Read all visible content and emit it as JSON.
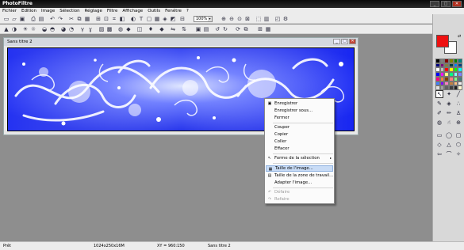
{
  "app": {
    "title": "PhotoFiltre",
    "window_buttons": [
      "_",
      "□",
      "✕"
    ]
  },
  "menubar": [
    "Fichier",
    "Edition",
    "Image",
    "Sélection",
    "Réglage",
    "Filtre",
    "Affichage",
    "Outils",
    "Fenêtre",
    "?"
  ],
  "toolbar": {
    "zoom_value": "100%",
    "zoom_dropdown_icon": "▾"
  },
  "document": {
    "title": "Sans titre 2",
    "buttons": [
      "_",
      "□",
      "✕"
    ]
  },
  "context_menu": {
    "items": [
      {
        "label": "Enregistrer",
        "icon": "save-icon",
        "glyph": "▣"
      },
      {
        "label": "Enregistrer sous...",
        "icon": "",
        "glyph": ""
      },
      {
        "label": "Fermer",
        "icon": "",
        "glyph": ""
      },
      {
        "label": "Couper",
        "icon": "",
        "glyph": ""
      },
      {
        "label": "Copier",
        "icon": "",
        "glyph": ""
      },
      {
        "label": "Coller",
        "icon": "",
        "glyph": ""
      },
      {
        "label": "Effacer",
        "icon": "",
        "glyph": ""
      },
      {
        "label": "Forme de la sélection",
        "icon": "pointer-icon",
        "glyph": "↖",
        "submenu_arrow": "▸"
      },
      {
        "label": "Taille de l'image...",
        "icon": "image-size-icon",
        "glyph": "▦"
      },
      {
        "label": "Taille de la zone de travail...",
        "icon": "canvas-size-icon",
        "glyph": "▤"
      },
      {
        "label": "Adapter l'image...",
        "icon": "",
        "glyph": ""
      },
      {
        "label": "Défaire",
        "icon": "undo-icon",
        "glyph": "↶"
      },
      {
        "label": "Refaire",
        "icon": "redo-icon",
        "glyph": "↷"
      }
    ]
  },
  "statusbar": {
    "state": "Prêt",
    "dimensions": "1024x250x16M",
    "coords": "XY = 960:150",
    "doc_name": "Sans titre 2"
  },
  "colors": {
    "foreground": "#ee1111",
    "background": "#ffffff",
    "swap_glyph": "⇄",
    "palette": [
      "#000000",
      "#808080",
      "#800000",
      "#808000",
      "#008000",
      "#008080",
      "#000080",
      "#800080",
      "#808040",
      "#004040",
      "#0080ff",
      "#004080",
      "#ffffff",
      "#c0c0c0",
      "#ff0000",
      "#ffff00",
      "#00ff00",
      "#00ffff",
      "#0000ff",
      "#ff00ff",
      "#ffff80",
      "#00ff80",
      "#80ffff",
      "#8080ff",
      "#ff0080",
      "#ff8040",
      "#804000",
      "#ff8080",
      "#80ff80",
      "#408080",
      "#4080ff",
      "#8000ff",
      "#ff80c0",
      "#c08040",
      "#ffc080",
      "#f0f0f0",
      "#e0e0e0",
      "#a0a0a0",
      "#606060",
      "#404040",
      "#202020",
      "#fff8d0"
    ]
  },
  "tools": [
    {
      "name": "pointer-tool",
      "glyph": "↖",
      "selected": true
    },
    {
      "name": "magic-wand-tool",
      "glyph": "✦"
    },
    {
      "name": "line-tool",
      "glyph": "╱"
    },
    {
      "name": "eyedropper-tool",
      "glyph": "✎"
    },
    {
      "name": "fill-tool",
      "glyph": "◈"
    },
    {
      "name": "spray-tool",
      "glyph": "∴"
    },
    {
      "name": "brush-tool",
      "glyph": "✐"
    },
    {
      "name": "pencil-tool",
      "glyph": "✏"
    },
    {
      "name": "stamp-tool",
      "glyph": "♙"
    },
    {
      "name": "blur-tool",
      "glyph": "◍"
    },
    {
      "name": "smudge-tool",
      "glyph": "☝"
    },
    {
      "name": "clone-tool",
      "glyph": "⊕"
    },
    {
      "name": "rectangle-shape-tool",
      "glyph": "▭"
    },
    {
      "name": "ellipse-shape-tool",
      "glyph": "◯"
    },
    {
      "name": "rounded-rect-shape-tool",
      "glyph": "▢"
    },
    {
      "name": "diamond-shape-tool",
      "glyph": "◇"
    },
    {
      "name": "triangle-shape-tool",
      "glyph": "△"
    },
    {
      "name": "polygon-shape-tool",
      "glyph": "⬡"
    },
    {
      "name": "arrow-shape-tool",
      "glyph": "⇦"
    },
    {
      "name": "lasso-shape-tool",
      "glyph": "⌒"
    },
    {
      "name": "custom-shape-tool",
      "glyph": "✧"
    }
  ]
}
